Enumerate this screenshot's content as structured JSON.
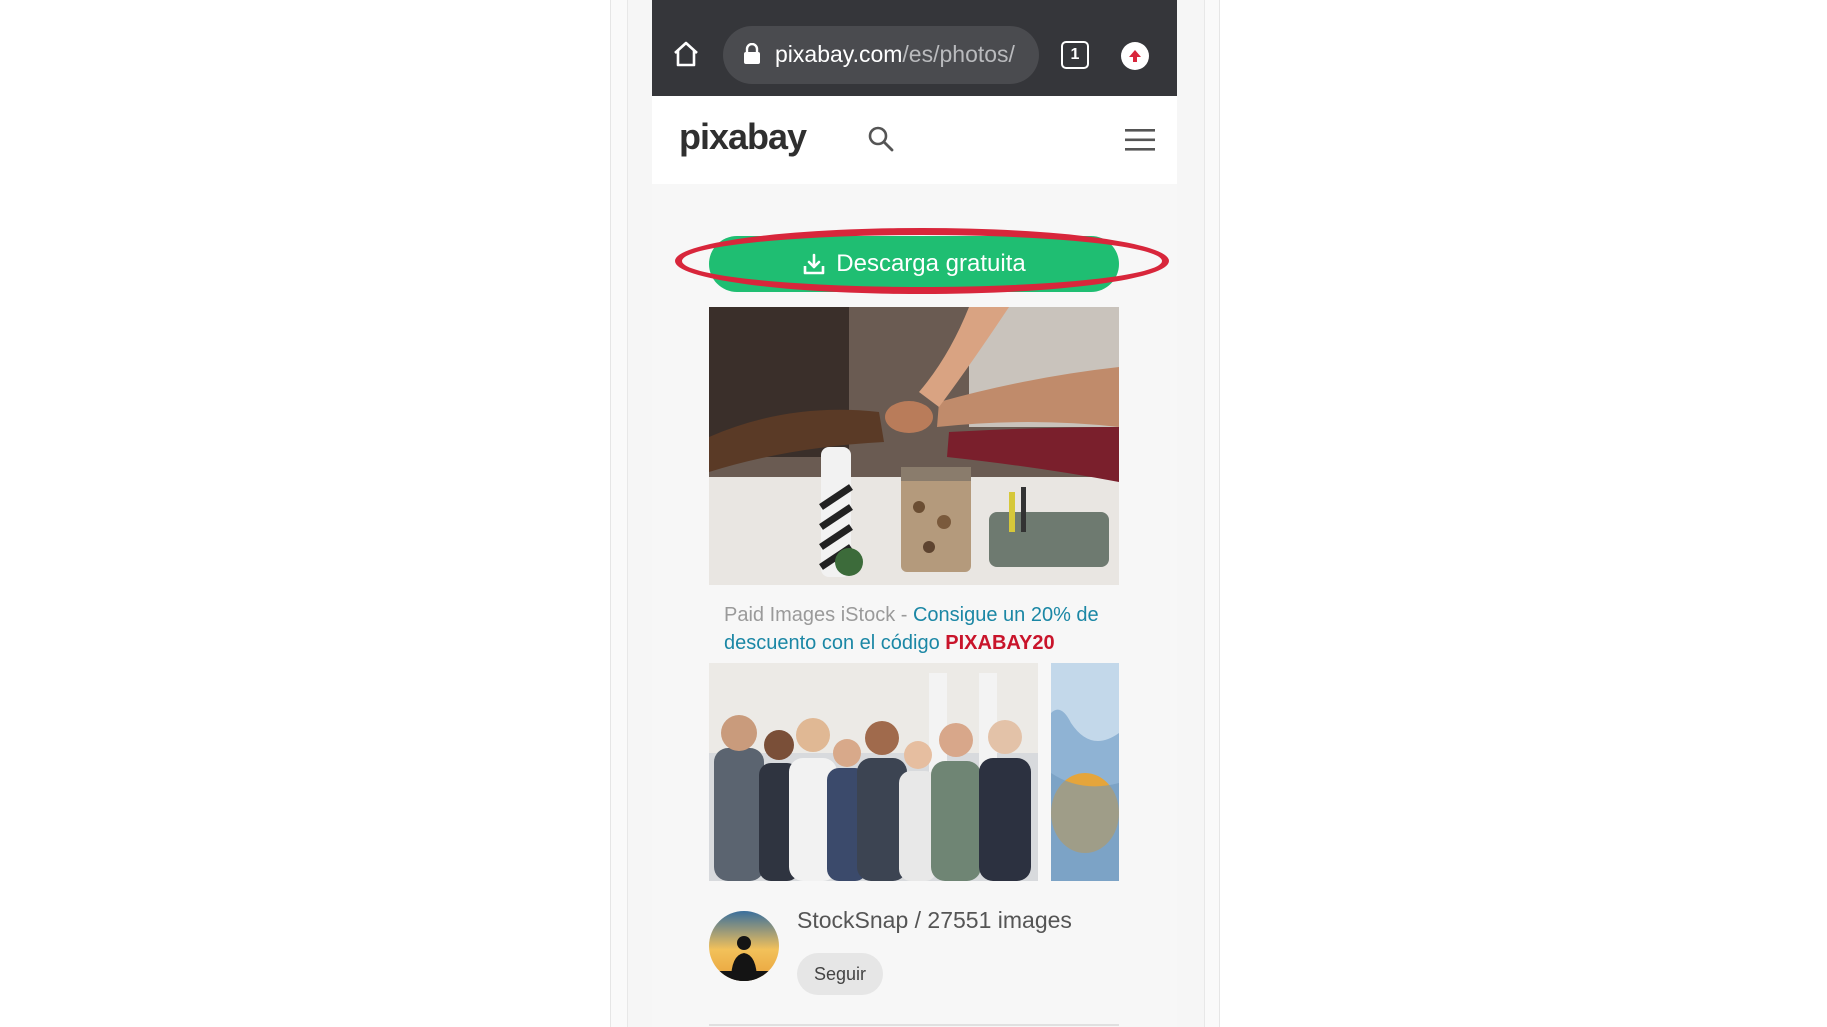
{
  "browser": {
    "url_domain": "pixabay.com",
    "url_path": "/es/photos/",
    "tab_count": "1"
  },
  "site": {
    "logo": "pixabay"
  },
  "main": {
    "download_label": "Descarga gratuita",
    "promo_prefix": "Paid Images iStock - ",
    "promo_link": "Consigue un 20% de descuento con el código ",
    "promo_code": "PIXABAY20"
  },
  "author": {
    "name_line": "StockSnap / 27551 images",
    "follow_label": "Seguir"
  },
  "colors": {
    "toolbar": "#35363a",
    "download_green": "#1fbe72",
    "highlight_red": "#d8263b",
    "link_teal": "#1b87a5",
    "code_red": "#c9142b"
  }
}
